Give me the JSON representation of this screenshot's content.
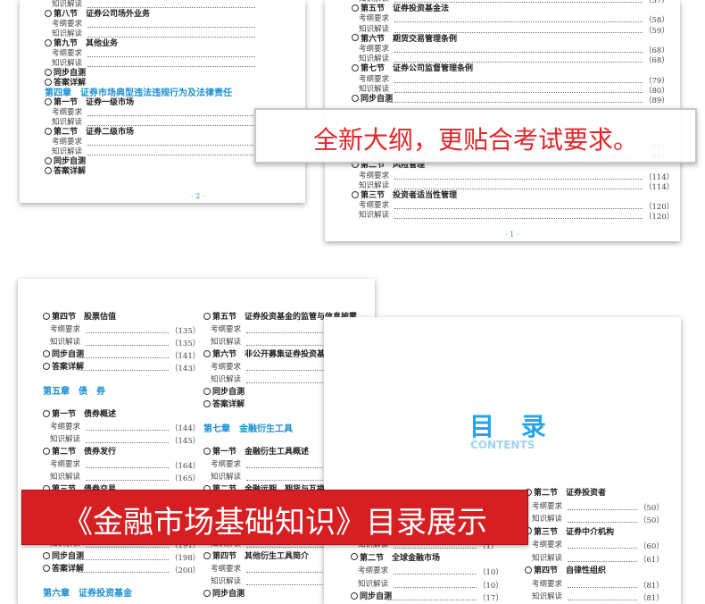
{
  "banner_top": "全新大纲，更贴合考试要求。",
  "banner_bottom": "《金融市场基础知识》目录展示",
  "title_mulu": "目 录",
  "title_contents": "CONTENTS",
  "p1_footer": "· 2 ·",
  "p2_footer": "· 1 ·",
  "p1_rows": [
    {
      "t": "知识解读",
      "k": "sub"
    },
    {
      "t": "第八节　证券公司场外业务",
      "k": "sec"
    },
    {
      "t": "考纲要求",
      "k": "sub"
    },
    {
      "t": "知识解读",
      "k": "sub"
    },
    {
      "t": "第九节　其他业务",
      "k": "sec"
    },
    {
      "t": "考纲要求",
      "k": "sub"
    },
    {
      "t": "知识解读",
      "k": "sub"
    },
    {
      "t": "同步自测",
      "k": "sec"
    },
    {
      "t": "答案详解",
      "k": "sec"
    },
    {
      "t": "第四章　证券市场典型违法违规行为及法律责任",
      "k": "chap"
    },
    {
      "t": "第一节　证券一级市场",
      "k": "sec"
    },
    {
      "t": "考纲要求",
      "k": "sub"
    },
    {
      "t": "知识解读",
      "k": "sub"
    },
    {
      "t": "第二节　证券二级市场",
      "k": "sec"
    },
    {
      "t": "考纲要求",
      "k": "sub"
    },
    {
      "t": "知识解读",
      "k": "sub"
    },
    {
      "t": "同步自测",
      "k": "sec"
    },
    {
      "t": "答案详解",
      "k": "sec"
    }
  ],
  "p2_rows": [
    {
      "t": "知识解读",
      "k": "sub",
      "p": "（37）"
    },
    {
      "t": "第五节　证券投资基金法",
      "k": "sec",
      "p": ""
    },
    {
      "t": "考纲要求",
      "k": "sub",
      "p": "（58）"
    },
    {
      "t": "知识解读",
      "k": "sub",
      "p": "（59）"
    },
    {
      "t": "第六节　期货交易管理条例",
      "k": "sec",
      "p": ""
    },
    {
      "t": "考纲要求",
      "k": "sub",
      "p": "（68）"
    },
    {
      "t": "知识解读",
      "k": "sub",
      "p": "（68）"
    },
    {
      "t": "第七节　证券公司监督管理条例",
      "k": "sec",
      "p": ""
    },
    {
      "t": "考纲要求",
      "k": "sub",
      "p": "（79）"
    },
    {
      "t": "知识解读",
      "k": "sub",
      "p": "（80）"
    },
    {
      "t": "同步自测",
      "k": "sec",
      "p": "（89）"
    }
  ],
  "p2_rows_b": [
    {
      "t": "",
      "k": "sub",
      "p": "（95）"
    },
    {
      "t": "",
      "k": "sub",
      "p": "（95）"
    },
    {
      "t": "第二节　风险管理",
      "k": "sec",
      "p": ""
    },
    {
      "t": "考纲要求",
      "k": "sub",
      "p": "（114）"
    },
    {
      "t": "知识解读",
      "k": "sub",
      "p": "（114）"
    },
    {
      "t": "第三节　投资者适当性管理",
      "k": "sec",
      "p": ""
    },
    {
      "t": "考纲要求",
      "k": "sub",
      "p": "（120）"
    },
    {
      "t": "知识解读",
      "k": "sub",
      "p": "（120）"
    }
  ],
  "p3_left": [
    {
      "t": "第四节　股票估值",
      "k": "sec",
      "p": ""
    },
    {
      "t": "考纲要求",
      "k": "sub",
      "p": "（135）"
    },
    {
      "t": "知识解读",
      "k": "sub",
      "p": "（135）"
    },
    {
      "t": "同步自测",
      "k": "sec",
      "p": "（141）"
    },
    {
      "t": "答案详解",
      "k": "sec",
      "p": "（143）"
    },
    {
      "t": "",
      "k": "gap",
      "p": ""
    },
    {
      "t": "第五章　债　券",
      "k": "chap",
      "p": ""
    },
    {
      "t": "",
      "k": "gap",
      "p": ""
    },
    {
      "t": "第一节　债券概述",
      "k": "sec",
      "p": ""
    },
    {
      "t": "考纲要求",
      "k": "sub",
      "p": "（144）"
    },
    {
      "t": "知识解读",
      "k": "sub",
      "p": "（145）"
    },
    {
      "t": "第二节　债券发行",
      "k": "sec",
      "p": ""
    },
    {
      "t": "考纲要求",
      "k": "sub",
      "p": "（164）"
    },
    {
      "t": "知识解读",
      "k": "sub",
      "p": "（165）"
    },
    {
      "t": "第三节　债券交易",
      "k": "sec",
      "p": ""
    }
  ],
  "p3_left_b": [
    {
      "t": "知识解读",
      "k": "sub",
      "p": "（191）"
    },
    {
      "t": "同步自测",
      "k": "sec",
      "p": "（198）"
    },
    {
      "t": "答案详解",
      "k": "sec",
      "p": "（200）"
    },
    {
      "t": "",
      "k": "gap",
      "p": ""
    },
    {
      "t": "第六章　证券投资基金",
      "k": "chap",
      "p": ""
    }
  ],
  "p3_right": [
    {
      "t": "第五节　证券投资基金的监管与信息披露",
      "k": "sec"
    },
    {
      "t": "考纲要求",
      "k": "sub"
    },
    {
      "t": "知识解读",
      "k": "sub"
    },
    {
      "t": "第六节　非公开募集证券投资基金",
      "k": "sec"
    },
    {
      "t": "考纲要求",
      "k": "sub"
    },
    {
      "t": "知识解读",
      "k": "sub"
    },
    {
      "t": "同步自测",
      "k": "sec"
    },
    {
      "t": "答案详解",
      "k": "sec"
    },
    {
      "t": "",
      "k": "gap"
    },
    {
      "t": "第七章　金融衍生工具",
      "k": "chap"
    },
    {
      "t": "",
      "k": "gap"
    },
    {
      "t": "第一节　金融衍生工具概述",
      "k": "sec"
    },
    {
      "t": "考纲要求",
      "k": "sub"
    },
    {
      "t": "知识解读",
      "k": "sub"
    },
    {
      "t": "第二节　金融远期、期货与互换",
      "k": "sec"
    }
  ],
  "p3_right_b": [
    {
      "t": "知识解读",
      "k": "sub"
    },
    {
      "t": "第四节　其他衍生工具简介",
      "k": "sec"
    },
    {
      "t": "考纲要求",
      "k": "sub"
    },
    {
      "t": "知识解读",
      "k": "sub"
    },
    {
      "t": "同步自测",
      "k": "sec"
    }
  ],
  "p4_rows": [
    {
      "t": "第二节　证券投资者",
      "k": "sec",
      "p": ""
    },
    {
      "t": "考纲要求",
      "k": "sub",
      "p": "（50）"
    },
    {
      "t": "知识解读",
      "k": "sub",
      "p": "（50）"
    },
    {
      "t": "第三节　证券中介机构",
      "k": "sec",
      "p": ""
    },
    {
      "t": "考纲要求",
      "k": "sub",
      "p": "（60）"
    },
    {
      "t": "知识解读",
      "k": "sub",
      "p": "（61）"
    },
    {
      "t": "第四节　自律性组织",
      "k": "sec",
      "p": ""
    },
    {
      "t": "考纲要求",
      "k": "sub",
      "p": "（81）"
    },
    {
      "t": "知识解读",
      "k": "sub",
      "p": "（81）"
    }
  ],
  "p4_left": [
    {
      "t": "知识解读",
      "k": "sub",
      "p": "（1）"
    },
    {
      "t": "第二节　全球金融市场",
      "k": "sec",
      "p": ""
    },
    {
      "t": "考纲要求",
      "k": "sub",
      "p": "（10）"
    },
    {
      "t": "知识解读",
      "k": "sub",
      "p": "（10）"
    },
    {
      "t": "同步自测",
      "k": "sec",
      "p": "（17）"
    }
  ]
}
